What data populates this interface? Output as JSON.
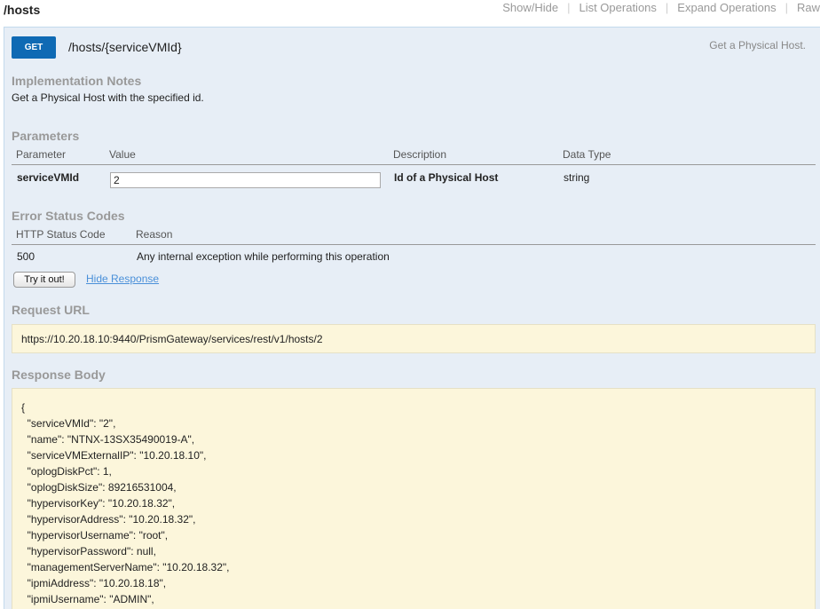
{
  "header": {
    "resource": "/hosts",
    "links": [
      "Show/Hide",
      "List Operations",
      "Expand Operations",
      "Raw"
    ]
  },
  "operation": {
    "method": "GET",
    "path": "/hosts/{serviceVMId}",
    "summary": "Get a Physical Host."
  },
  "implementation_notes": {
    "heading": "Implementation Notes",
    "text": "Get a Physical Host with the specified id."
  },
  "parameters": {
    "heading": "Parameters",
    "columns": [
      "Parameter",
      "Value",
      "Description",
      "Data Type"
    ],
    "rows": [
      {
        "name": "serviceVMId",
        "value": "2",
        "description": "Id of a Physical Host",
        "data_type": "string"
      }
    ]
  },
  "error_codes": {
    "heading": "Error Status Codes",
    "columns": [
      "HTTP Status Code",
      "Reason"
    ],
    "rows": [
      {
        "code": "500",
        "reason": "Any internal exception while performing this operation"
      }
    ]
  },
  "actions": {
    "try_label": "Try it out!",
    "hide_label": "Hide Response"
  },
  "request_url": {
    "heading": "Request URL",
    "url": "https://10.20.18.10:9440/PrismGateway/services/rest/v1/hosts/2"
  },
  "response_body": {
    "heading": "Response Body",
    "lines": [
      "{",
      "  \"serviceVMId\": \"2\",",
      "  \"name\": \"NTNX-13SX35490019-A\",",
      "  \"serviceVMExternalIP\": \"10.20.18.10\",",
      "  \"oplogDiskPct\": 1,",
      "  \"oplogDiskSize\": 89216531004,",
      "  \"hypervisorKey\": \"10.20.18.32\",",
      "  \"hypervisorAddress\": \"10.20.18.32\",",
      "  \"hypervisorUsername\": \"root\",",
      "  \"hypervisorPassword\": null,",
      "  \"managementServerName\": \"10.20.18.32\",",
      "  \"ipmiAddress\": \"10.20.18.18\",",
      "  \"ipmiUsername\": \"ADMIN\","
    ]
  }
}
